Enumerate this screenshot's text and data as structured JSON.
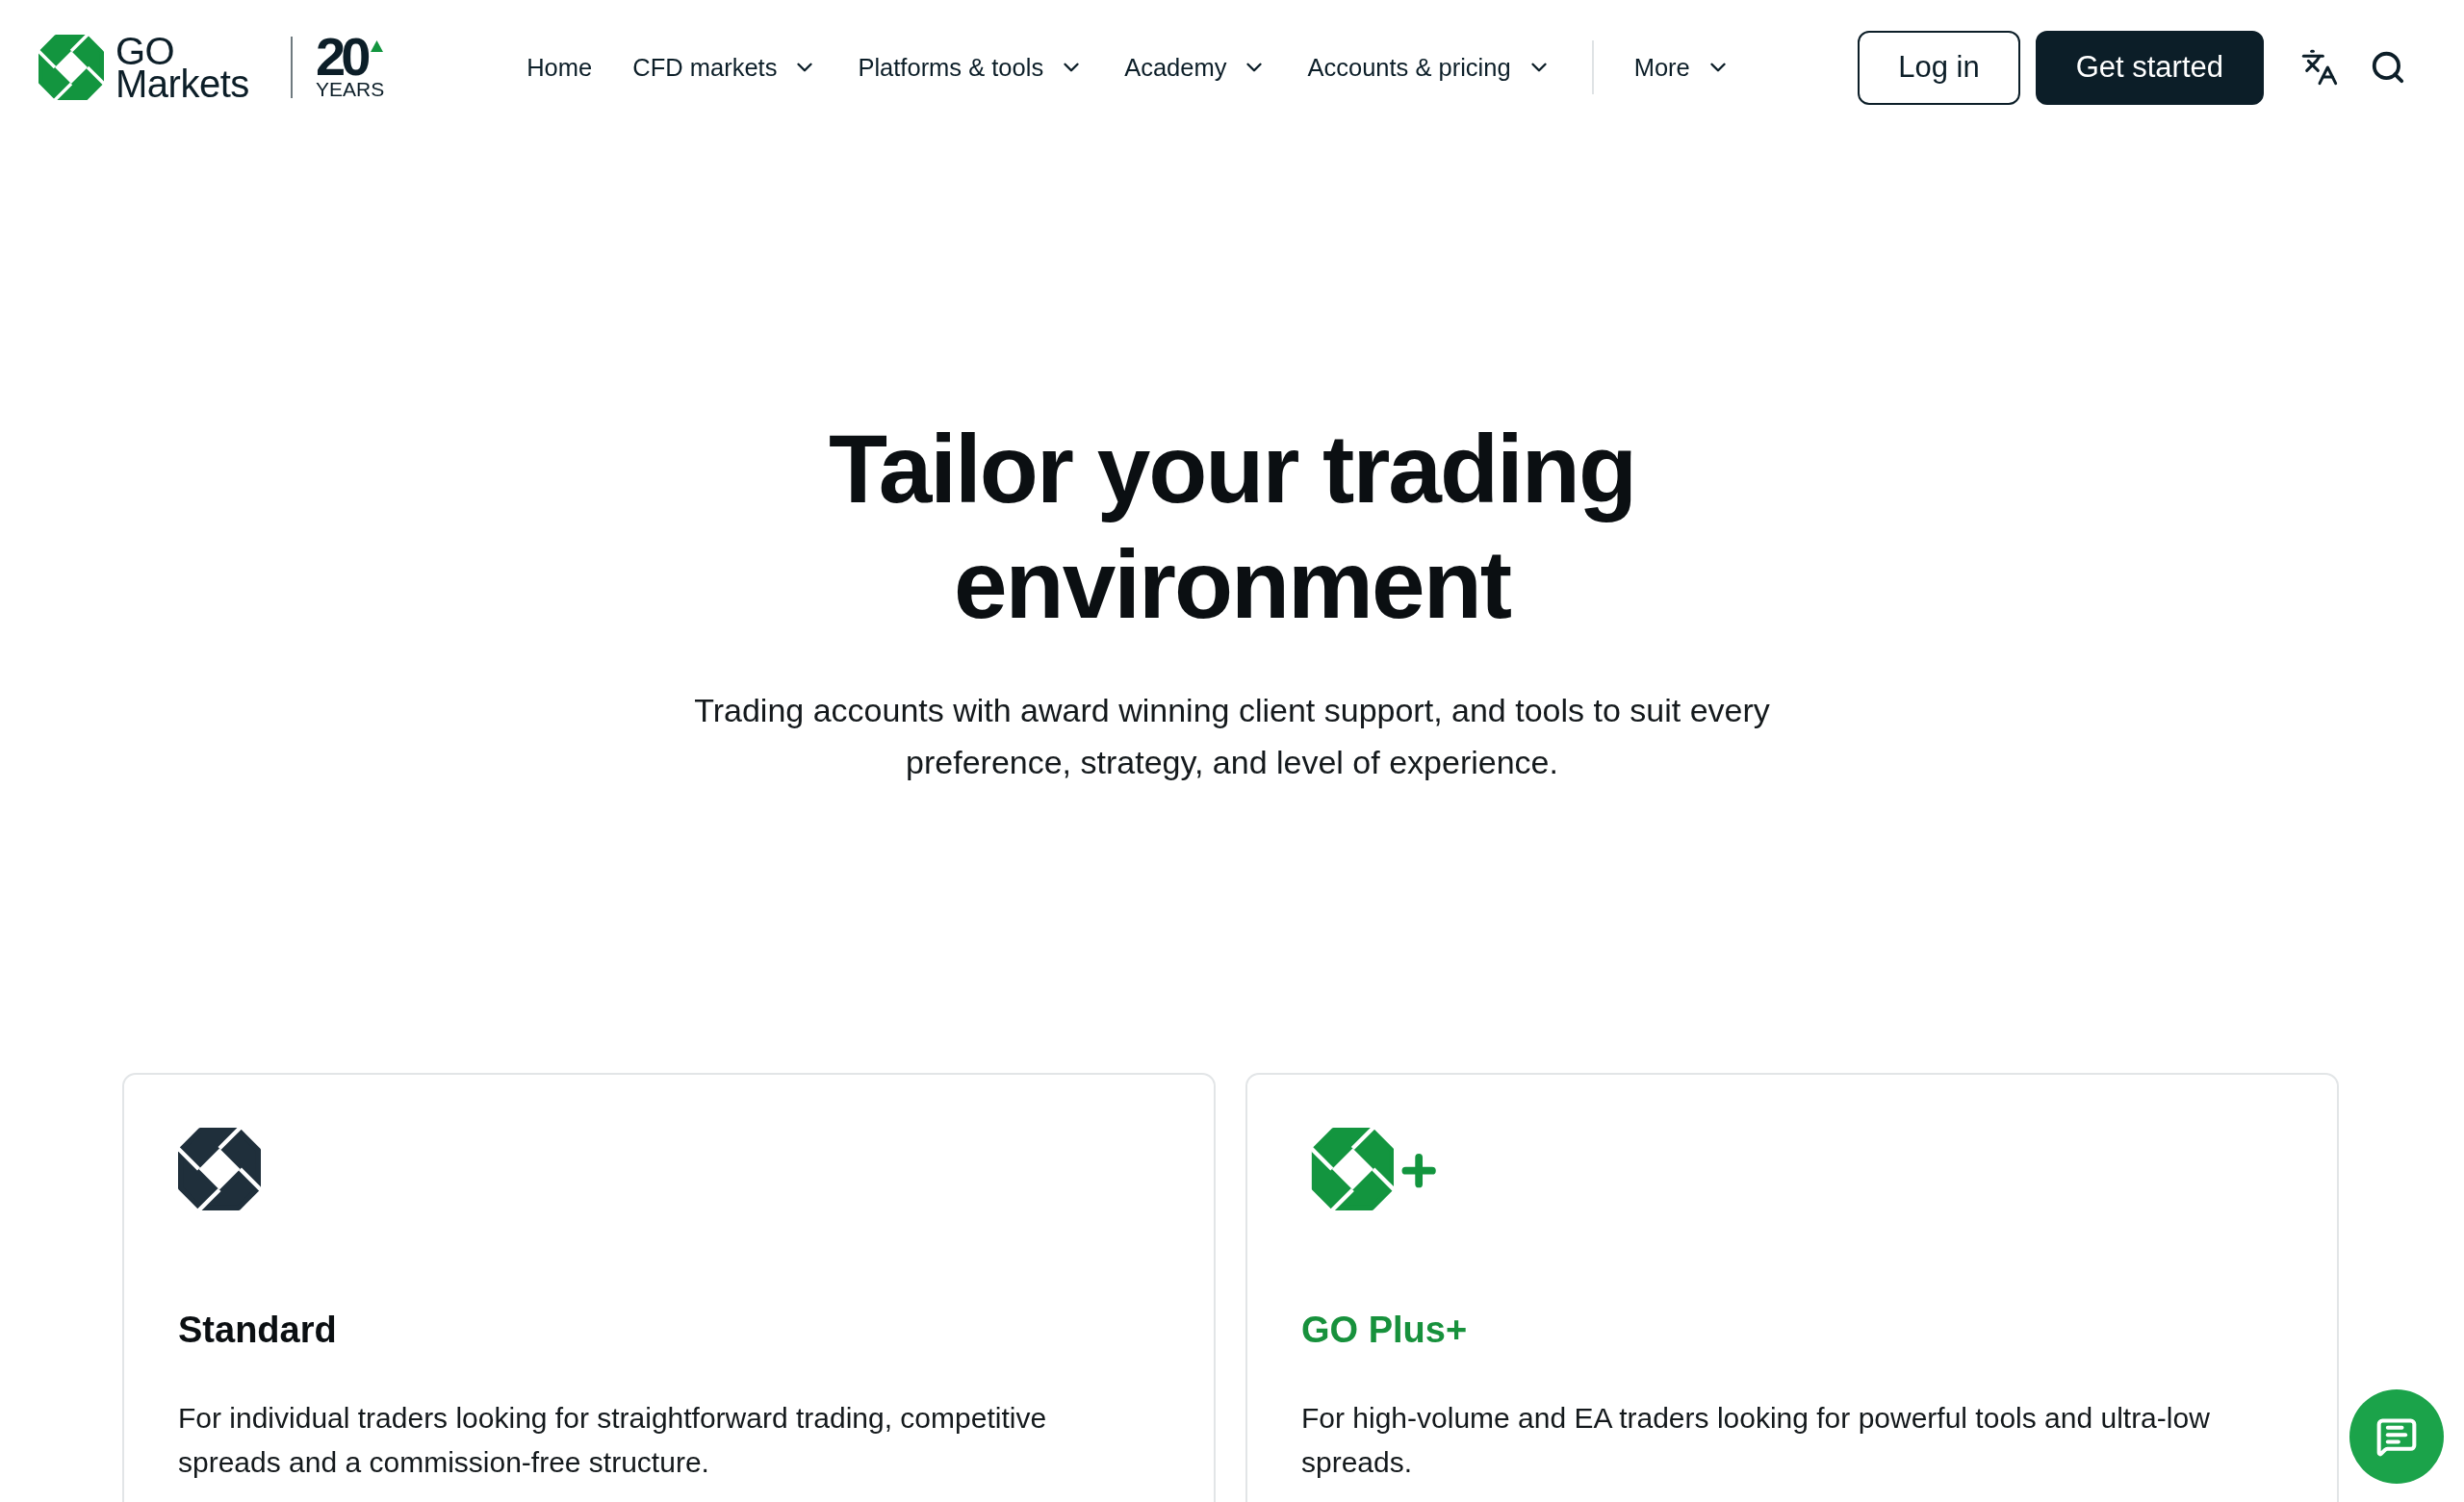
{
  "header": {
    "logo": {
      "wordmark": "GO Markets",
      "anniversary_number": "20",
      "anniversary_label": "YEARS"
    },
    "nav": [
      {
        "label": "Home",
        "has_dropdown": false
      },
      {
        "label": "CFD markets",
        "has_dropdown": true
      },
      {
        "label": "Platforms & tools",
        "has_dropdown": true
      },
      {
        "label": "Academy",
        "has_dropdown": true
      },
      {
        "label": "Accounts & pricing",
        "has_dropdown": true
      }
    ],
    "more": {
      "label": "More",
      "has_dropdown": true
    },
    "buttons": [
      {
        "label": "Log in",
        "kind": "outline"
      },
      {
        "label": "Get started",
        "kind": "filled"
      }
    ]
  },
  "hero": {
    "title": "Tailor your trading environment",
    "subtitle": "Trading accounts with award winning client support, and tools to suit every preference, strategy, and level of experience."
  },
  "account_cards": [
    {
      "kind": "standard",
      "title": "Standard",
      "description": "For individual traders looking for straightforward trading, competitive spreads and a commission-free structure."
    },
    {
      "kind": "plus",
      "title": "GO Plus+",
      "description": "For high-volume and EA traders looking for powerful tools and ultra-low spreads."
    }
  ]
}
